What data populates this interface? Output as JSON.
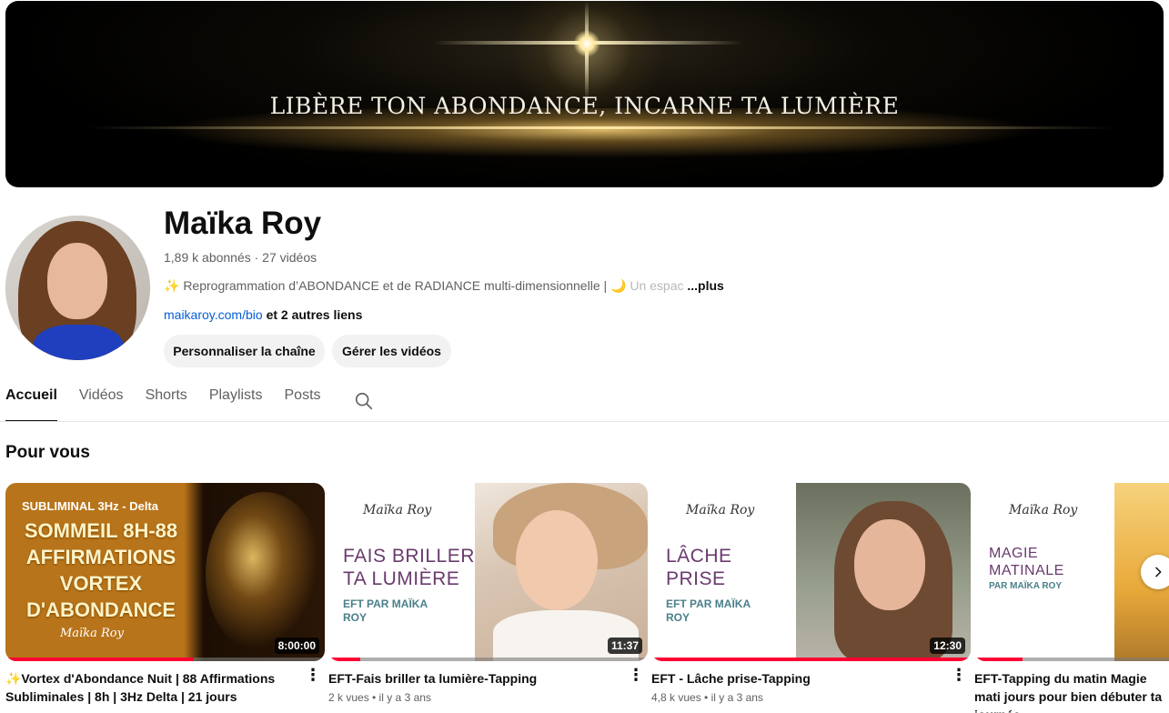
{
  "banner": {
    "tagline": "LIBÈRE TON ABONDANCE, INCARNE TA LUMIÈRE"
  },
  "channel": {
    "name": "Maïka Roy",
    "meta": "1,89 k abonnés · 27 vidéos",
    "description_visible": "✨ Reprogrammation d’ABONDANCE et de RADIANCE multi-dimensionnelle | 🌙",
    "description_faded": "Un espac",
    "more_label": "...plus",
    "link_text": "maikaroy.com/bio",
    "other_links": "et 2 autres liens"
  },
  "actions": {
    "customize": "Personnaliser la chaîne",
    "manage": "Gérer les vidéos"
  },
  "tabs": [
    {
      "label": "Accueil",
      "active": true
    },
    {
      "label": "Vidéos",
      "active": false
    },
    {
      "label": "Shorts",
      "active": false
    },
    {
      "label": "Playlists",
      "active": false
    },
    {
      "label": "Posts",
      "active": false
    }
  ],
  "section": {
    "title": "Pour vous"
  },
  "videos": [
    {
      "title": "✨Vortex d'Abondance Nuit | 88 Affirmations Subliminales | 8h | 3Hz Delta | 21 jours",
      "duration": "8:00:00",
      "progress": 0.59,
      "meta": "",
      "thumb": {
        "top": "SUBLIMINAL 3Hz - Delta",
        "headline": "SOMMEIL 8H-88 AFFIRMATIONS VORTEX D'ABONDANCE",
        "signature": "Maïka Roy"
      }
    },
    {
      "title": "EFT-Fais briller ta lumière-Tapping",
      "duration": "11:37",
      "progress": 0.1,
      "meta": "2 k vues • il y a 3 ans",
      "thumb": {
        "signature": "Maïka Roy",
        "headline": "FAIS BRILLER TA LUMIÈRE",
        "byline": "EFT PAR MAÏKA ROY"
      }
    },
    {
      "title": "EFT - Lâche prise-Tapping",
      "duration": "12:30",
      "progress": 1.0,
      "meta": "4,8 k vues • il y a 3 ans",
      "thumb": {
        "signature": "Maïka Roy",
        "headline": "LÂCHE PRISE",
        "byline": "EFT PAR MAÏKA ROY"
      }
    },
    {
      "title": "EFT-Tapping du matin Magie mati jours pour bien débuter ta journée",
      "duration": "",
      "progress": 0.15,
      "meta": "",
      "thumb": {
        "signature": "Maïka Roy",
        "headline": "MAGIE MATINALE",
        "byline": "PAR MAÏKA ROY"
      }
    }
  ],
  "icons": {
    "search": "search-icon",
    "next": "chevron-right-icon",
    "more": "more-vert-icon"
  }
}
